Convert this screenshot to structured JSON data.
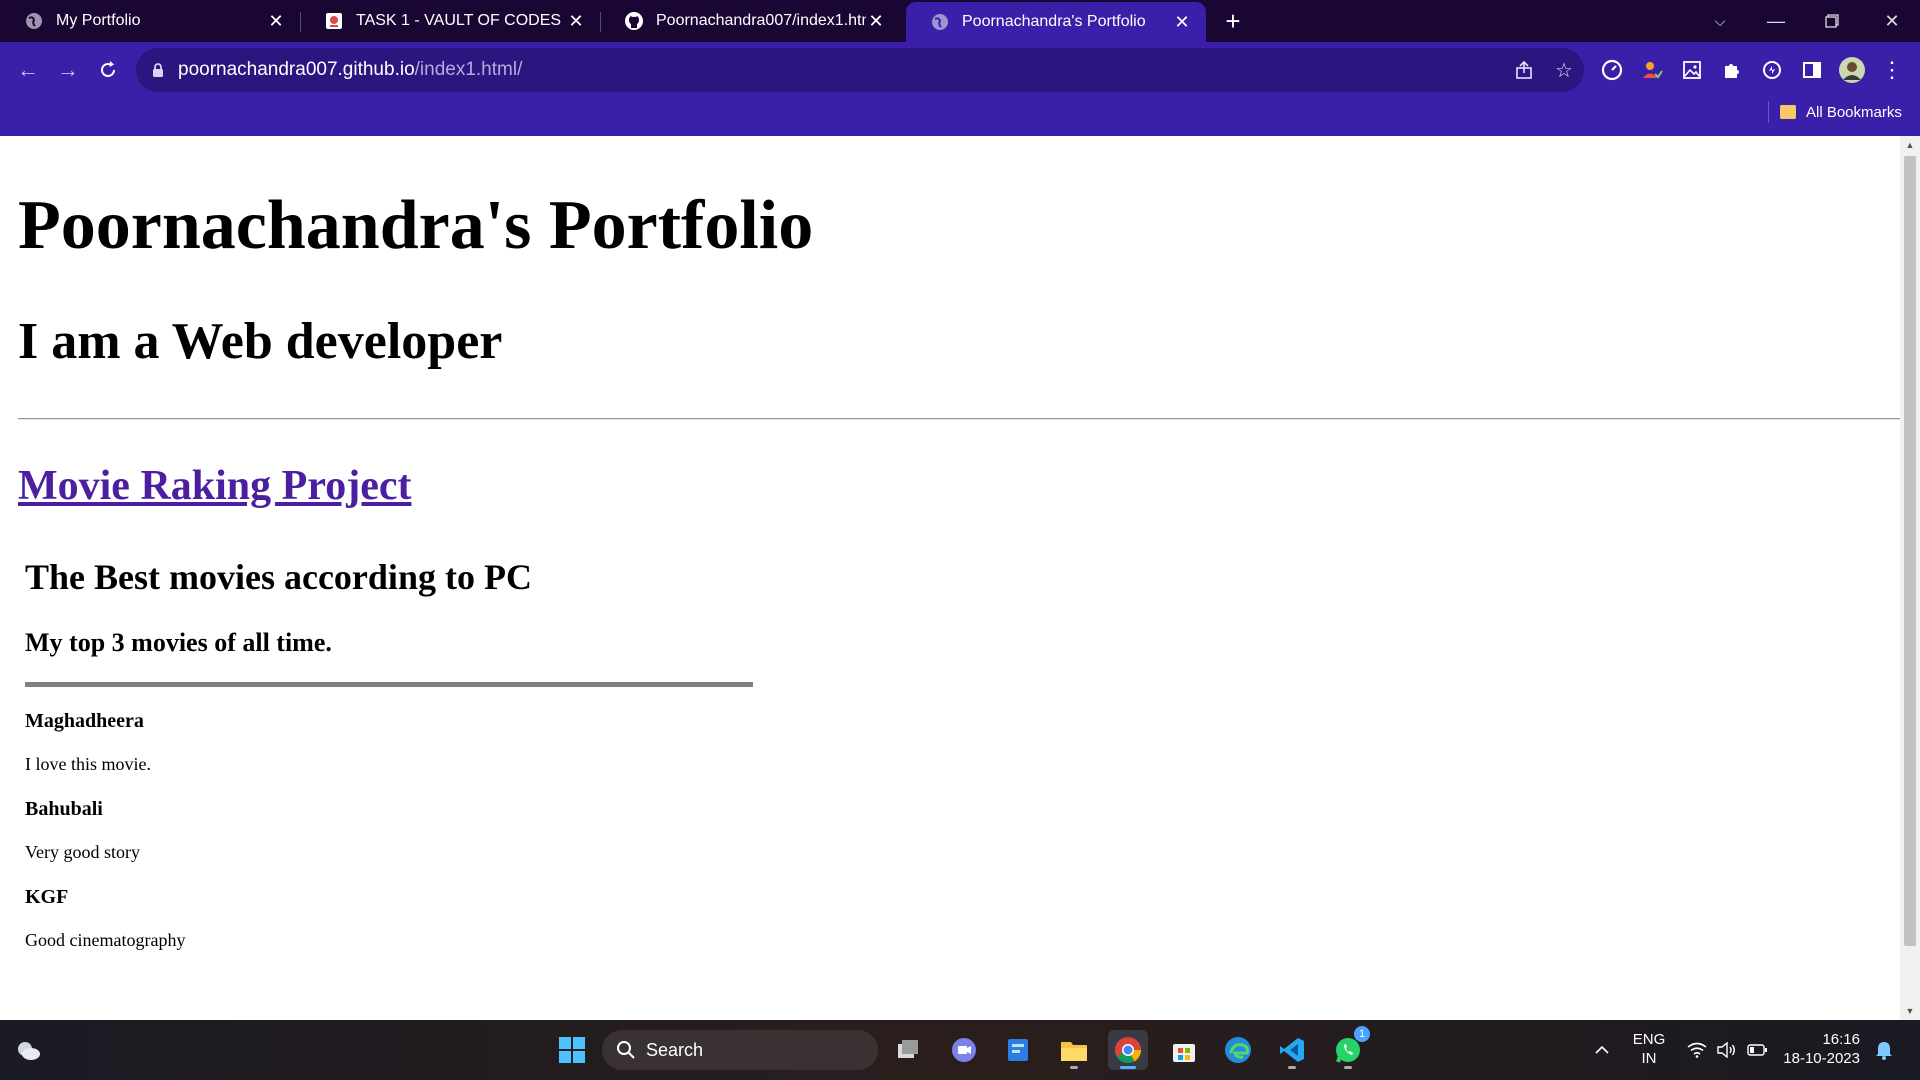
{
  "browser": {
    "tabs": [
      {
        "title": "My Portfolio",
        "active": false
      },
      {
        "title": "TASK 1 - VAULT OF CODES",
        "active": false
      },
      {
        "title": "Poornachandra007/index1.html",
        "active": false
      },
      {
        "title": "Poornachandra's Portfolio",
        "active": true
      }
    ],
    "new_tab_label": "+",
    "address": {
      "host": "poornachandra007.github.io",
      "path": "/index1.html/"
    },
    "bookmarks_label": "All Bookmarks",
    "icons": {
      "back": "arrow-left-icon",
      "forward": "arrow-right-icon",
      "reload": "reload-icon",
      "lock": "lock-icon",
      "share": "share-icon",
      "star": "star-icon",
      "extensions": "puzzle-icon",
      "menu": "kebab-menu-icon"
    },
    "colors": {
      "frame": "#1a0633",
      "toolbar": "#3a1fa8",
      "omnibox": "#2b1680"
    }
  },
  "page": {
    "title": "Poornachandra's Portfolio",
    "subtitle": "I am a Web developer",
    "project_link": "Movie Raking Project",
    "section_title": "The Best movies according to PC",
    "section_subtitle": "My top 3 movies of all time.",
    "movies": [
      {
        "title": "Maghadheera",
        "description": "I love this movie."
      },
      {
        "title": "Bahubali",
        "description": "Very good story"
      },
      {
        "title": "KGF",
        "description": "Good cinematography"
      }
    ],
    "link_color": "#4b1fa0"
  },
  "taskbar": {
    "search_placeholder": "Search",
    "language": "ENG",
    "region": "IN",
    "time": "16:16",
    "date": "18-10-2023",
    "whatsapp_badge": "1"
  }
}
